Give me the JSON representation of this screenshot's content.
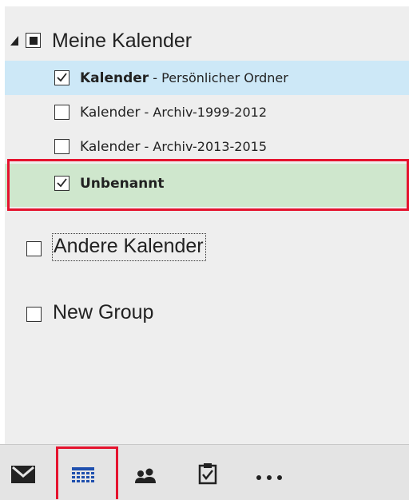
{
  "group_mine": {
    "label": "Meine Kalender",
    "items": [
      {
        "name": "Kalender",
        "suffix": " - Persönlicher Ordner",
        "checked": true
      },
      {
        "name": "Kalender",
        "suffix": " - Archiv-1999-2012",
        "checked": false
      },
      {
        "name": "Kalender",
        "suffix": " - Archiv-2013-2015",
        "checked": false
      },
      {
        "name": "Unbenannt",
        "suffix": "",
        "checked": true
      }
    ]
  },
  "group_other": {
    "label": "Andere Kalender",
    "checked": false
  },
  "group_new": {
    "label": "New Group",
    "checked": false
  },
  "bottom_nav": {
    "items": [
      "mail-icon",
      "calendar-icon",
      "people-icon",
      "tasks-icon",
      "more-icon"
    ],
    "active": "calendar-icon"
  },
  "colors": {
    "selected_row": "#cde8f7",
    "added_row": "#cfe7cd",
    "highlight_box": "#e5132e",
    "calendar_accent": "#1e4fae"
  }
}
